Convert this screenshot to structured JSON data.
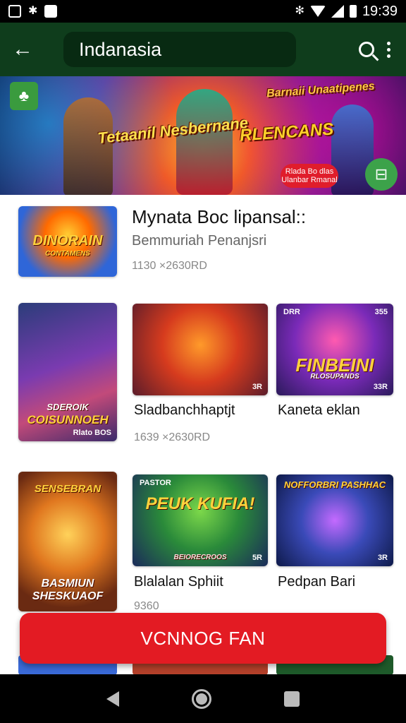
{
  "status_bar": {
    "time": "19:39",
    "icons": [
      "notification-square-icon",
      "bug-icon",
      "image-icon",
      "bluetooth-icon",
      "wifi-icon",
      "signal-icon",
      "battery-icon"
    ]
  },
  "app_bar": {
    "title": "Indanasia",
    "back_icon": "arrow-left-icon",
    "search_icon": "search-icon",
    "menu_icon": "more-vert-icon"
  },
  "banner": {
    "text_left": "Tetaanil Nesbernane",
    "text_mid": "RLENCANS",
    "text_right": "Barnaii Unaatipenes",
    "pill_text": "Rlada Bo dlas Ulanbar Rmanal",
    "badge_left_icon": "tree-icon",
    "badge_right_icon": "store-icon"
  },
  "feature": {
    "title": "Mynata Boc lipansal::",
    "subtitle": "Bemmuriah Penanjsri",
    "meta": "1130 ×2630RD",
    "thumb_label": "DINORAIN",
    "thumb_sub": "CONTAMENS"
  },
  "row1": {
    "big": {
      "label_top": "SDEROIK",
      "label_bottom": "COISUNNOEH",
      "corner": "Rlato BOS"
    },
    "cards": [
      {
        "title": "Sladbanchhaptjt",
        "meta": "1639 ×2630RD",
        "corner": "3R"
      },
      {
        "title": "Kaneta eklan",
        "corner_tl": "DRR",
        "corner_tr": "355",
        "corner": "33R",
        "art_title": "FINBEINI",
        "art_sub": "RLOSUPANDS"
      }
    ]
  },
  "row2": {
    "big": {
      "label_top": "SENSEBRAN",
      "label_bottom": "BASMIUN SHESKUAOF"
    },
    "cards": [
      {
        "title": "Blalalan Sphiit",
        "meta": "9360",
        "art_title": "PEUK KUFIA!",
        "art_corner_tl": "PASTOR",
        "art_bottom": "BEIORECROOS",
        "corner": "5R"
      },
      {
        "title": "Pedpan Bari",
        "art_title": "NOFFORBRI PASHHAC",
        "corner": "3R"
      }
    ]
  },
  "cta": {
    "label": "VCNNOG FAN"
  },
  "nav_bar": {
    "back_icon": "nav-back-icon",
    "home_icon": "nav-home-icon",
    "recents_icon": "nav-recents-icon"
  }
}
